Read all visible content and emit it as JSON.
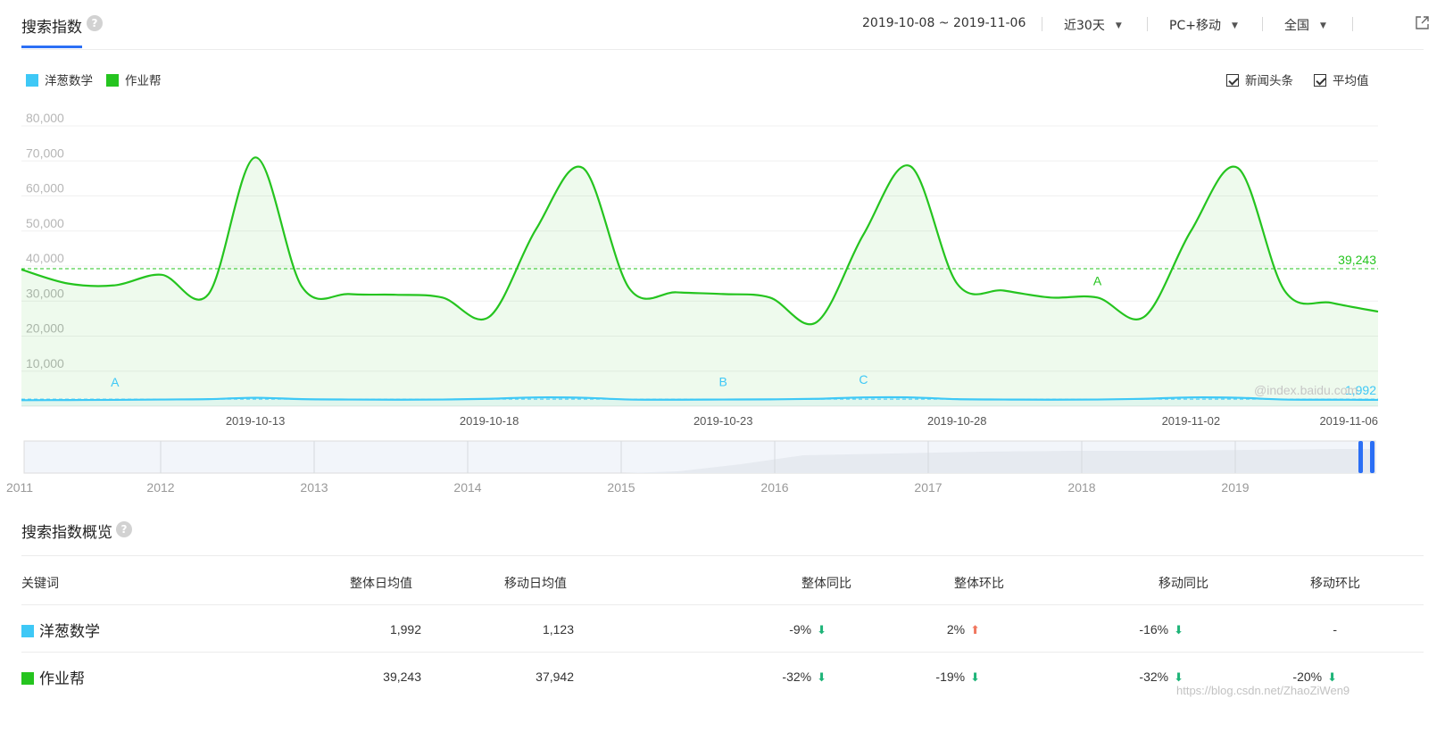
{
  "header": {
    "title": "搜索指数",
    "date_range": "2019-10-08 ~ 2019-11-06",
    "period": "近30天",
    "device": "PC+移动",
    "region": "全国"
  },
  "legend": {
    "items": [
      {
        "label": "洋葱数学",
        "color": "#3ec8f6"
      },
      {
        "label": "作业帮",
        "color": "#25c41f"
      }
    ],
    "checkboxes": [
      {
        "label": "新闻头条",
        "checked": true
      },
      {
        "label": "平均值",
        "checked": true
      }
    ]
  },
  "chart_data": {
    "type": "line",
    "ylim": [
      0,
      80000
    ],
    "yticks": [
      "80,000",
      "70,000",
      "60,000",
      "50,000",
      "40,000",
      "30,000",
      "20,000",
      "10,000"
    ],
    "x": [
      "2019-10-08",
      "2019-10-09",
      "2019-10-10",
      "2019-10-11",
      "2019-10-12",
      "2019-10-13",
      "2019-10-14",
      "2019-10-15",
      "2019-10-16",
      "2019-10-17",
      "2019-10-18",
      "2019-10-19",
      "2019-10-20",
      "2019-10-21",
      "2019-10-22",
      "2019-10-23",
      "2019-10-24",
      "2019-10-25",
      "2019-10-26",
      "2019-10-27",
      "2019-10-28",
      "2019-10-29",
      "2019-10-30",
      "2019-10-31",
      "2019-11-01",
      "2019-11-02",
      "2019-11-03",
      "2019-11-04",
      "2019-11-05",
      "2019-11-06"
    ],
    "xtick_labels": [
      "2019-10-13",
      "2019-10-18",
      "2019-10-23",
      "2019-10-28",
      "2019-11-02",
      "2019-11-06"
    ],
    "series": [
      {
        "name": "作业帮",
        "color": "#25c41f",
        "values": [
          39000,
          35000,
          34500,
          37500,
          32000,
          71000,
          34000,
          32000,
          31800,
          31000,
          25500,
          50500,
          68000,
          33500,
          32500,
          32000,
          31000,
          24000,
          49000,
          68500,
          35000,
          33000,
          31000,
          31000,
          25500,
          50000,
          68000,
          33000,
          29500,
          27000
        ],
        "average": 39243,
        "average_label": "39,243"
      },
      {
        "name": "洋葱数学",
        "color": "#3ec8f6",
        "values": [
          1700,
          1750,
          1800,
          1900,
          2000,
          2400,
          2000,
          1900,
          1850,
          1900,
          2100,
          2500,
          2400,
          1900,
          1850,
          1900,
          1950,
          2100,
          2500,
          2500,
          2000,
          1900,
          1850,
          1900,
          2100,
          2500,
          2400,
          1900,
          1850,
          1800
        ],
        "average": 1992,
        "average_label": "1,992"
      }
    ],
    "annotations": [
      {
        "label": "A",
        "series": "洋葱数学",
        "x": "2019-10-10"
      },
      {
        "label": "B",
        "series": "洋葱数学",
        "x": "2019-10-23"
      },
      {
        "label": "C",
        "series": "洋葱数学",
        "x": "2019-10-26"
      },
      {
        "label": "A",
        "series": "作业帮",
        "x": "2019-10-31"
      }
    ],
    "watermark": "@index.baidu.com"
  },
  "navigator": {
    "years": [
      "2011",
      "2012",
      "2013",
      "2014",
      "2015",
      "2016",
      "2017",
      "2018",
      "2019"
    ]
  },
  "overview": {
    "title": "搜索指数概览",
    "headers": [
      "关键词",
      "整体日均值",
      "移动日均值",
      "整体同比",
      "整体环比",
      "移动同比",
      "移动环比"
    ],
    "rows": [
      {
        "keyword": "洋葱数学",
        "color": "#3ec8f6",
        "overall_avg": "1,992",
        "mobile_avg": "1,123",
        "overall_yoy": "-9%",
        "overall_yoy_dir": "down",
        "overall_mom": "2%",
        "overall_mom_dir": "up",
        "mobile_yoy": "-16%",
        "mobile_yoy_dir": "down",
        "mobile_mom": "-",
        "mobile_mom_dir": ""
      },
      {
        "keyword": "作业帮",
        "color": "#25c41f",
        "overall_avg": "39,243",
        "mobile_avg": "37,942",
        "overall_yoy": "-32%",
        "overall_yoy_dir": "down",
        "overall_mom": "-19%",
        "overall_mom_dir": "down",
        "mobile_yoy": "-32%",
        "mobile_yoy_dir": "down",
        "mobile_mom": "-20%",
        "mobile_mom_dir": "down"
      }
    ]
  },
  "footer_watermark": "https://blog.csdn.net/ZhaoZiWen9",
  "colors": {
    "accent": "#2b6ff5",
    "up": "#f0775f",
    "down": "#1eb478"
  }
}
